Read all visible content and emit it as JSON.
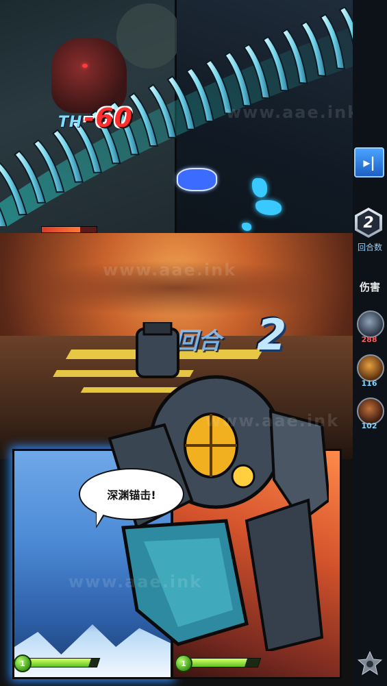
{
  "damage_popup": {
    "prefix": "TH",
    "value": "-60"
  },
  "round_banner": {
    "label": "回合",
    "number": "2"
  },
  "dialogue": {
    "text": "深渊锚击!"
  },
  "units": [
    {
      "level": "1",
      "hp_fraction": 0.88
    },
    {
      "level": "1",
      "hp_fraction": 0.82
    }
  ],
  "enemy_hp_fraction": 0.7,
  "sidebar": {
    "skip_glyph": "▸|",
    "round_number": "2",
    "round_label": "回合数",
    "damage_label": "伤害",
    "damage_list": [
      {
        "value": "288",
        "color": "#ff5a5a",
        "icon": "hero-portrait-1"
      },
      {
        "value": "116",
        "color": "#7fd4ff",
        "icon": "hero-portrait-2"
      },
      {
        "value": "102",
        "color": "#7fd4ff",
        "icon": "hero-portrait-3"
      }
    ]
  },
  "watermark": "www.aae.ink"
}
